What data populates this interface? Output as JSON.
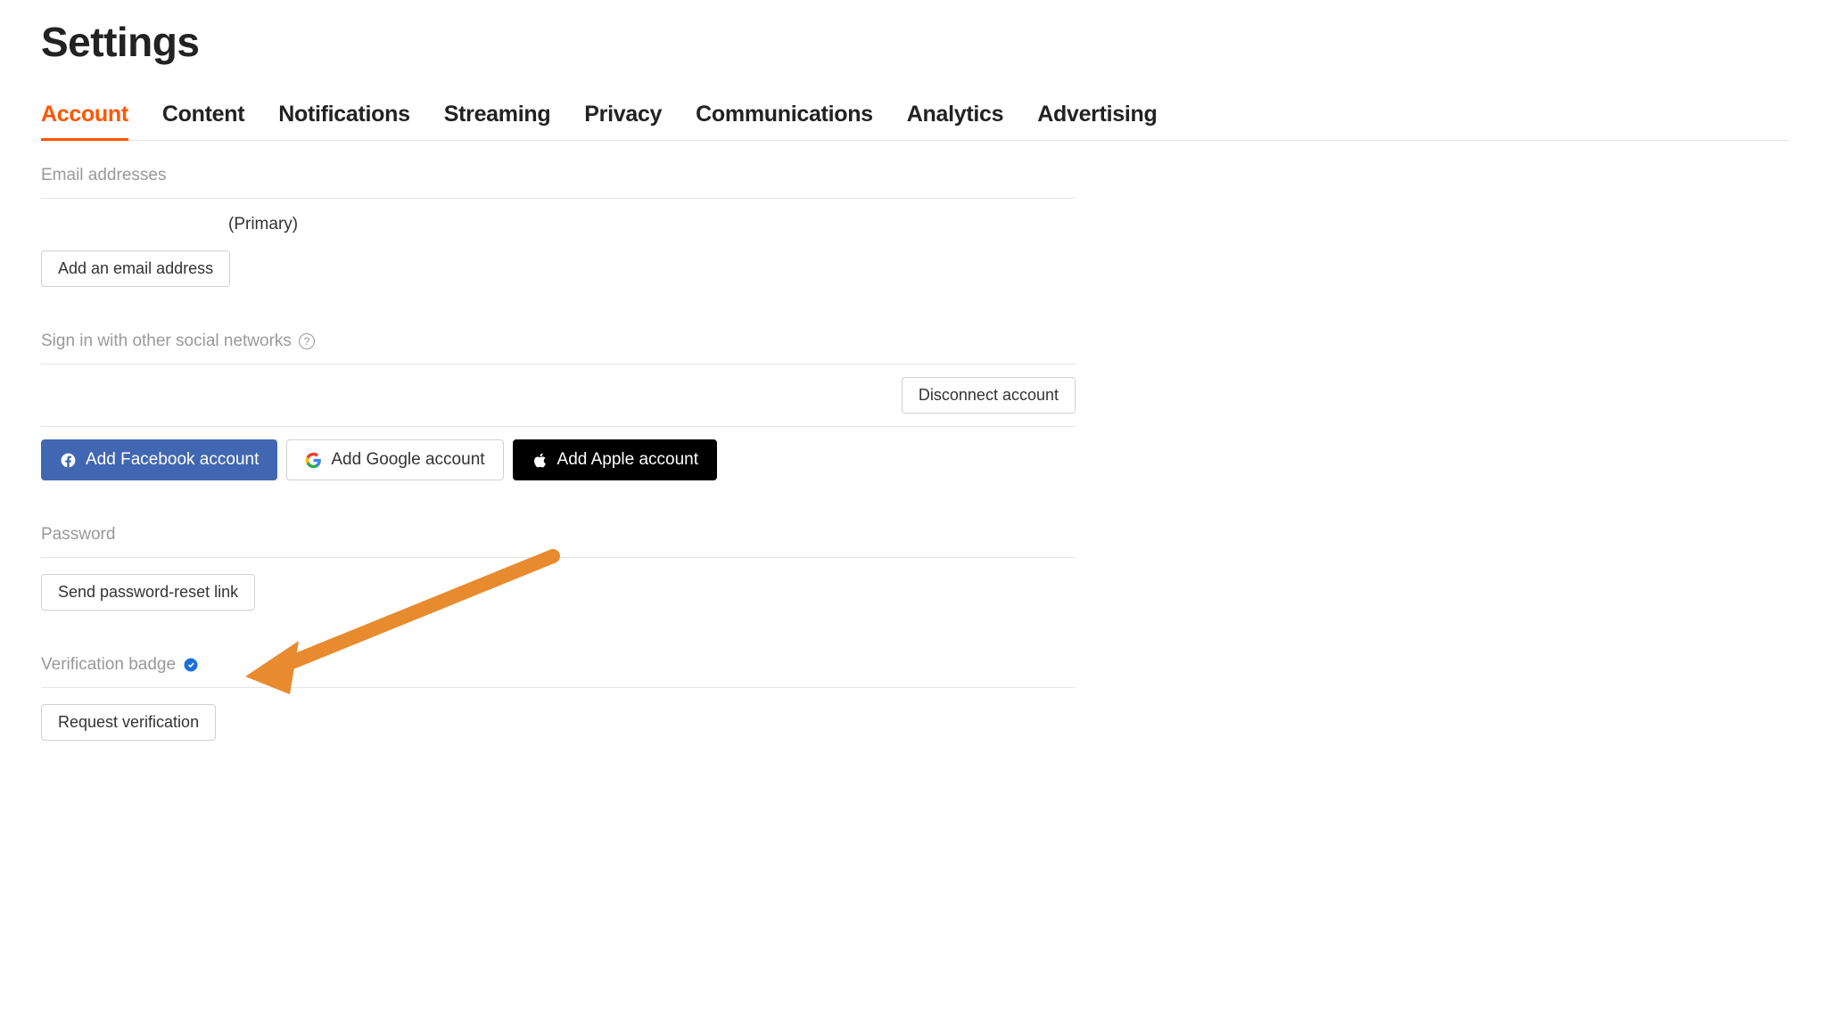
{
  "page": {
    "title": "Settings"
  },
  "tabs": [
    {
      "label": "Account",
      "active": true
    },
    {
      "label": "Content",
      "active": false
    },
    {
      "label": "Notifications",
      "active": false
    },
    {
      "label": "Streaming",
      "active": false
    },
    {
      "label": "Privacy",
      "active": false
    },
    {
      "label": "Communications",
      "active": false
    },
    {
      "label": "Analytics",
      "active": false
    },
    {
      "label": "Advertising",
      "active": false
    }
  ],
  "sections": {
    "email": {
      "title": "Email addresses",
      "primary_label": "(Primary)",
      "add_button": "Add an email address"
    },
    "social": {
      "title": "Sign in with other social networks",
      "disconnect_button": "Disconnect account",
      "facebook_button": "Add Facebook account",
      "google_button": "Add Google account",
      "apple_button": "Add Apple account"
    },
    "password": {
      "title": "Password",
      "reset_button": "Send password-reset link"
    },
    "verification": {
      "title": "Verification badge",
      "request_button": "Request verification"
    }
  },
  "colors": {
    "accent": "#f50",
    "facebook": "#4267B2",
    "apple": "#000000",
    "verify_badge": "#1d6fd8",
    "arrow": "#e88b2e"
  }
}
